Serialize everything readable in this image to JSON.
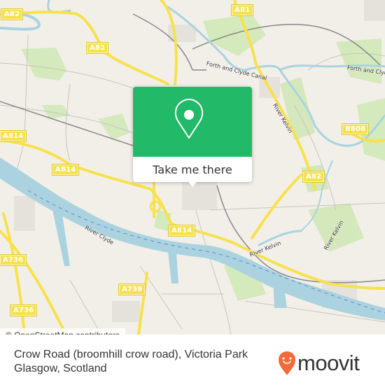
{
  "map": {
    "road_labels": [
      "A82",
      "A82",
      "A81",
      "A814",
      "A814",
      "A814",
      "A82",
      "B808",
      "A739",
      "A736",
      "A736"
    ],
    "water_labels": [
      "Forth and Clyde Canal",
      "Forth and Clyde",
      "River Kelvin",
      "River Clyde",
      "River Kelvin",
      "River Kelvin"
    ],
    "attribution": "© OpenStreetMap contributors"
  },
  "popup": {
    "icon": "map-pin-icon",
    "button_label": "Take me there",
    "color": "#22b968"
  },
  "footer": {
    "address_line1": "Crow Road (broomhill crow road), Victoria Park",
    "address_line2": "Glasgow, Scotland",
    "brand": "moovit",
    "brand_color": "#f26b3a"
  }
}
